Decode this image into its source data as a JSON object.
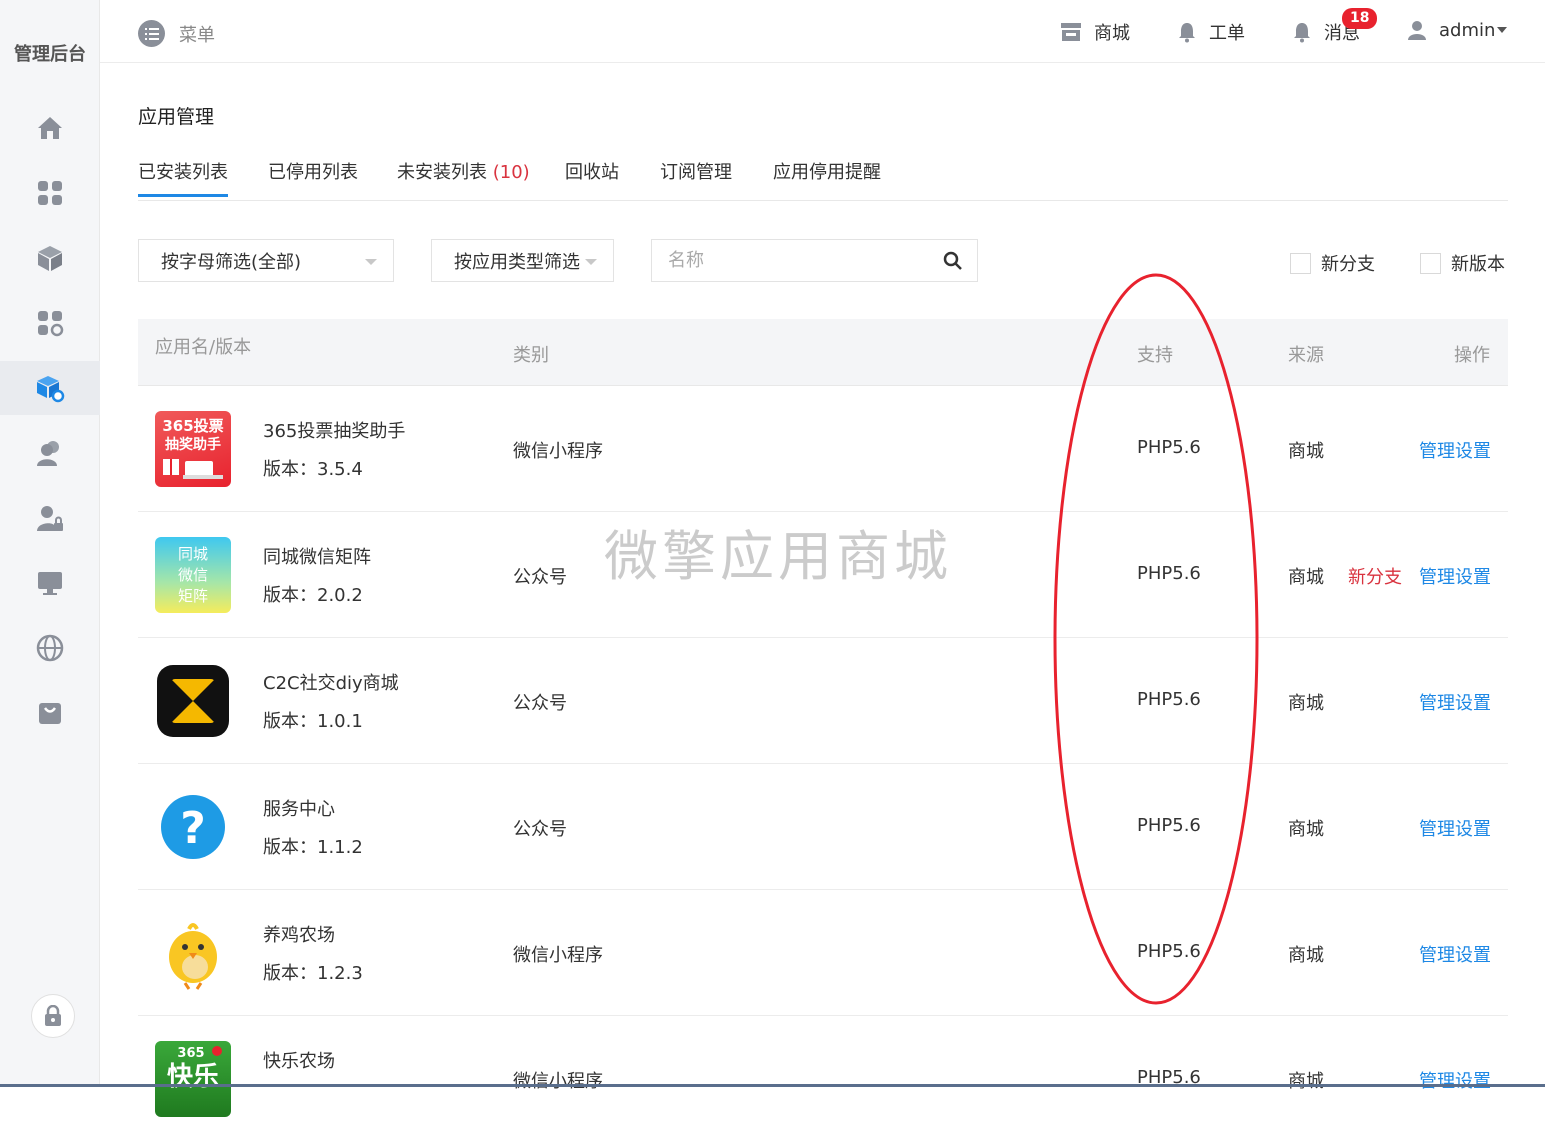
{
  "brand": "管理后台",
  "topbar": {
    "menu_label": "菜单",
    "store_label": "商城",
    "workorder_label": "工单",
    "messages_label": "消息",
    "messages_count": "18",
    "user_label": "admin"
  },
  "page": {
    "title": "应用管理",
    "tabs": [
      {
        "label": "已安装列表",
        "count": ""
      },
      {
        "label": "已停用列表",
        "count": ""
      },
      {
        "label": "未安装列表",
        "count": "(10)"
      },
      {
        "label": "回收站",
        "count": ""
      },
      {
        "label": "订阅管理",
        "count": ""
      },
      {
        "label": "应用停用提醒",
        "count": ""
      }
    ]
  },
  "filters": {
    "letter_filter": "按字母筛选(全部)",
    "type_filter": "按应用类型筛选",
    "search_placeholder": "名称",
    "new_branch_label": "新分支",
    "new_version_label": "新版本"
  },
  "table": {
    "headers": {
      "name": "应用名/版本",
      "category": "类别",
      "support": "支持",
      "source": "来源",
      "action": "操作"
    },
    "rows": [
      {
        "name": "365投票抽奖助手",
        "version": "版本：3.5.4",
        "category": "微信小程序",
        "support": "PHP5.6",
        "source": "商城",
        "branch": "",
        "action": "管理设置",
        "icon_text": "365投票抽奖助手"
      },
      {
        "name": "同城微信矩阵",
        "version": "版本：2.0.2",
        "category": "公众号",
        "support": "PHP5.6",
        "source": "商城",
        "branch": "新分支",
        "action": "管理设置",
        "icon_text": "同城微信矩阵"
      },
      {
        "name": "C2C社交diy商城",
        "version": "版本：1.0.1",
        "category": "公众号",
        "support": "PHP5.6",
        "source": "商城",
        "branch": "",
        "action": "管理设置",
        "icon_text": ""
      },
      {
        "name": "服务中心",
        "version": "版本：1.1.2",
        "category": "公众号",
        "support": "PHP5.6",
        "source": "商城",
        "branch": "",
        "action": "管理设置",
        "icon_text": "?"
      },
      {
        "name": "养鸡农场",
        "version": "版本：1.2.3",
        "category": "微信小程序",
        "support": "PHP5.6",
        "source": "商城",
        "branch": "",
        "action": "管理设置",
        "icon_text": ""
      },
      {
        "name": "快乐农场",
        "version": "",
        "category": "微信小程序",
        "support": "PHP5.6",
        "source": "商城",
        "branch": "",
        "action": "管理设置",
        "icon_text": "365快乐"
      }
    ]
  },
  "watermark": "微擎应用商城",
  "colors": {
    "accent": "#1e88e5",
    "danger": "#d9333f",
    "annotation": "#e8222e"
  }
}
